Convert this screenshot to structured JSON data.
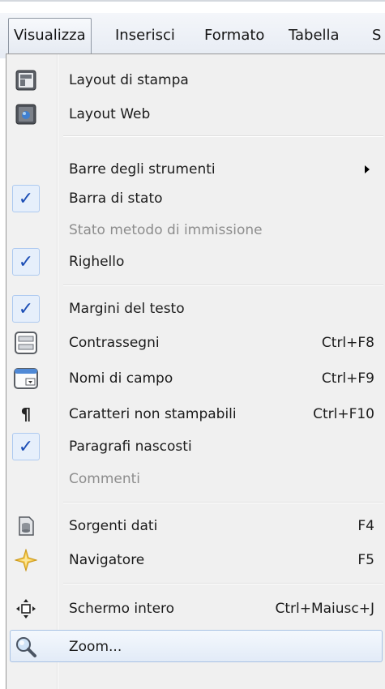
{
  "menubar": {
    "items": [
      {
        "label": "Visualizza",
        "active": true
      },
      {
        "label": "Inserisci"
      },
      {
        "label": "Formato"
      },
      {
        "label": "Tabella"
      },
      {
        "label": "S"
      }
    ]
  },
  "menu": {
    "items": [
      {
        "label": "Layout di stampa",
        "icon": "print-layout-icon"
      },
      {
        "label": "Layout Web",
        "icon": "web-layout-icon"
      },
      {
        "label": "Barre degli strumenti",
        "submenu": true
      },
      {
        "label": "Barra di stato",
        "checked": true
      },
      {
        "label": "Stato metodo di immissione",
        "disabled": true
      },
      {
        "label": "Righello",
        "checked": true
      },
      {
        "label": "Margini del testo",
        "checked": true
      },
      {
        "label": "Contrassegni",
        "shortcut": "Ctrl+F8",
        "icon": "field-shadings-icon"
      },
      {
        "label": "Nomi di campo",
        "shortcut": "Ctrl+F9",
        "icon": "field-names-icon"
      },
      {
        "label": "Caratteri non stampabili",
        "shortcut": "Ctrl+F10",
        "icon": "pilcrow-icon"
      },
      {
        "label": "Paragrafi nascosti",
        "checked": true
      },
      {
        "label": "Commenti",
        "disabled": true
      },
      {
        "label": "Sorgenti dati",
        "shortcut": "F4",
        "icon": "data-sources-icon"
      },
      {
        "label": "Navigatore",
        "shortcut": "F5",
        "icon": "navigator-icon"
      },
      {
        "label": "Schermo intero",
        "shortcut": "Ctrl+Maiusc+J",
        "icon": "full-screen-icon"
      },
      {
        "label": "Zoom...",
        "icon": "zoom-icon",
        "highlighted": true
      }
    ]
  },
  "colors": {
    "check": "#1b4db5",
    "highlight_border": "#a8c2e4",
    "disabled_text": "#8d8d8d"
  }
}
